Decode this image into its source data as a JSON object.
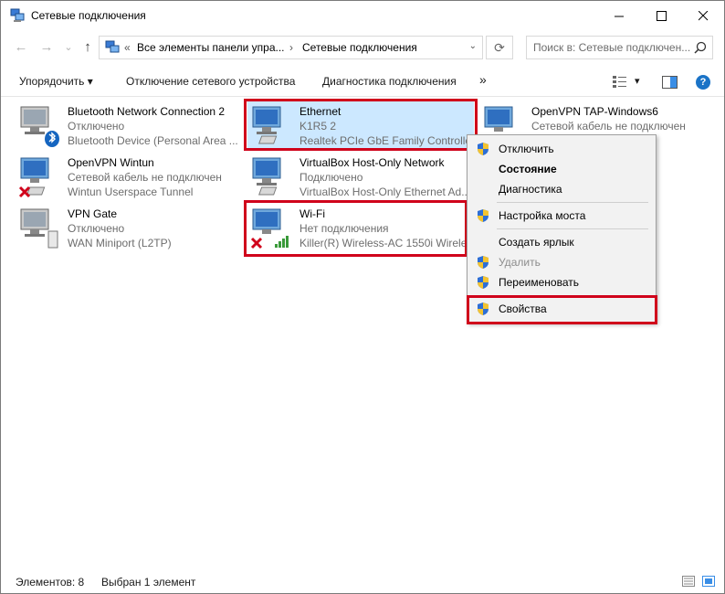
{
  "window": {
    "title": "Сетевые подключения",
    "controls": {
      "minimize": "—",
      "maximize": "☐",
      "close": "✕"
    }
  },
  "nav": {
    "back": "←",
    "forward": "→",
    "recent": "⌄",
    "up": "↑"
  },
  "address": {
    "chevron1": "«",
    "segment1": "Все элементы панели упра...",
    "chevron2": "›",
    "segment2": "Сетевые подключения",
    "dropdown": "⌄",
    "refresh": "⟳"
  },
  "search": {
    "placeholder": "Поиск в: Сетевые подключен..."
  },
  "toolbar": {
    "organize": "Упорядочить ▾",
    "disable": "Отключение сетевого устройства",
    "diagnose": "Диагностика подключения",
    "more": "»",
    "view_dropdown": "▾",
    "help": "?"
  },
  "connections": [
    {
      "name": "Bluetooth Network Connection 2",
      "status": "Отключено",
      "device": "Bluetooth Device (Personal Area ...",
      "icon": "bluetooth-adapter-icon"
    },
    {
      "name": "Ethernet",
      "status": "K1R5 2",
      "device": "Realtek PCIe GbE Family Controller",
      "icon": "ethernet-adapter-icon"
    },
    {
      "name": "OpenVPN TAP-Windows6",
      "status": "Сетевой кабель не подключен",
      "device": "",
      "icon": "vpn-adapter-icon"
    },
    {
      "name": "OpenVPN Wintun",
      "status": "Сетевой кабель не подключен",
      "device": "Wintun Userspace Tunnel",
      "icon": "disconnected-adapter-icon"
    },
    {
      "name": "VirtualBox Host-Only Network",
      "status": "Подключено",
      "device": "VirtualBox Host-Only Ethernet Ad...",
      "icon": "ethernet-adapter-icon"
    },
    {
      "name": "VPN Gate",
      "status": "Отключено",
      "device": "WAN Miniport (L2TP)",
      "icon": "vpn-adapter-icon"
    },
    {
      "name": "Wi-Fi",
      "status": "Нет подключения",
      "device": "Killer(R) Wireless-AC 1550i Wirele...",
      "icon": "wifi-adapter-icon"
    }
  ],
  "context_menu": {
    "items": [
      {
        "label": "Отключить",
        "shield": true,
        "bold": false,
        "disabled": false
      },
      {
        "label": "Состояние",
        "shield": false,
        "bold": true,
        "disabled": false
      },
      {
        "label": "Диагностика",
        "shield": false,
        "bold": false,
        "disabled": false
      },
      {
        "label": "Настройка моста",
        "shield": true,
        "bold": false,
        "disabled": false
      },
      {
        "label": "Создать ярлык",
        "shield": false,
        "bold": false,
        "disabled": false
      },
      {
        "label": "Удалить",
        "shield": true,
        "bold": false,
        "disabled": true
      },
      {
        "label": "Переименовать",
        "shield": true,
        "bold": false,
        "disabled": false
      },
      {
        "label": "Свойства",
        "shield": true,
        "bold": false,
        "disabled": false
      }
    ]
  },
  "statusbar": {
    "count": "Элементов: 8",
    "selected": "Выбран 1 элемент"
  },
  "colors": {
    "highlight_box": "#d0021b",
    "selection": "#cce8ff",
    "help_icon": "#1a73c7"
  }
}
